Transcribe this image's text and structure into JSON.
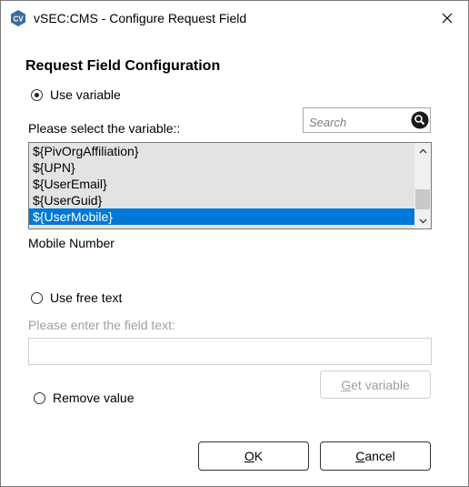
{
  "window": {
    "title": "vSEC:CMS - Configure Request Field",
    "app_icon_letters": "CV"
  },
  "section_title": "Request Field Configuration",
  "use_variable": {
    "label": "Use variable",
    "checked": true
  },
  "variable_prompt": "Please select the variable::",
  "search": {
    "placeholder": "Search",
    "value": ""
  },
  "variables": [
    "${PivOrgAffiliation}",
    "${UPN}",
    "${UserEmail}",
    "${UserGuid}",
    "${UserMobile}"
  ],
  "selected_variable_index": 4,
  "variable_description": "Mobile Number",
  "use_free_text": {
    "label": "Use free text",
    "checked": false
  },
  "free_text_prompt": "Please enter the field text:",
  "free_text_value": "",
  "get_variable_button": {
    "label_mnemonic": "G",
    "label_rest": "et variable"
  },
  "remove_value": {
    "label": "Remove value",
    "checked": false
  },
  "ok_button": {
    "label_mnemonic": "O",
    "label_rest": "K"
  },
  "cancel_button": {
    "label_mnemonic": "C",
    "label_rest": "ancel"
  },
  "colors": {
    "selection": "#0078d7",
    "list_background": "#e3e3e3",
    "disabled_text": "#a0a0a0"
  }
}
